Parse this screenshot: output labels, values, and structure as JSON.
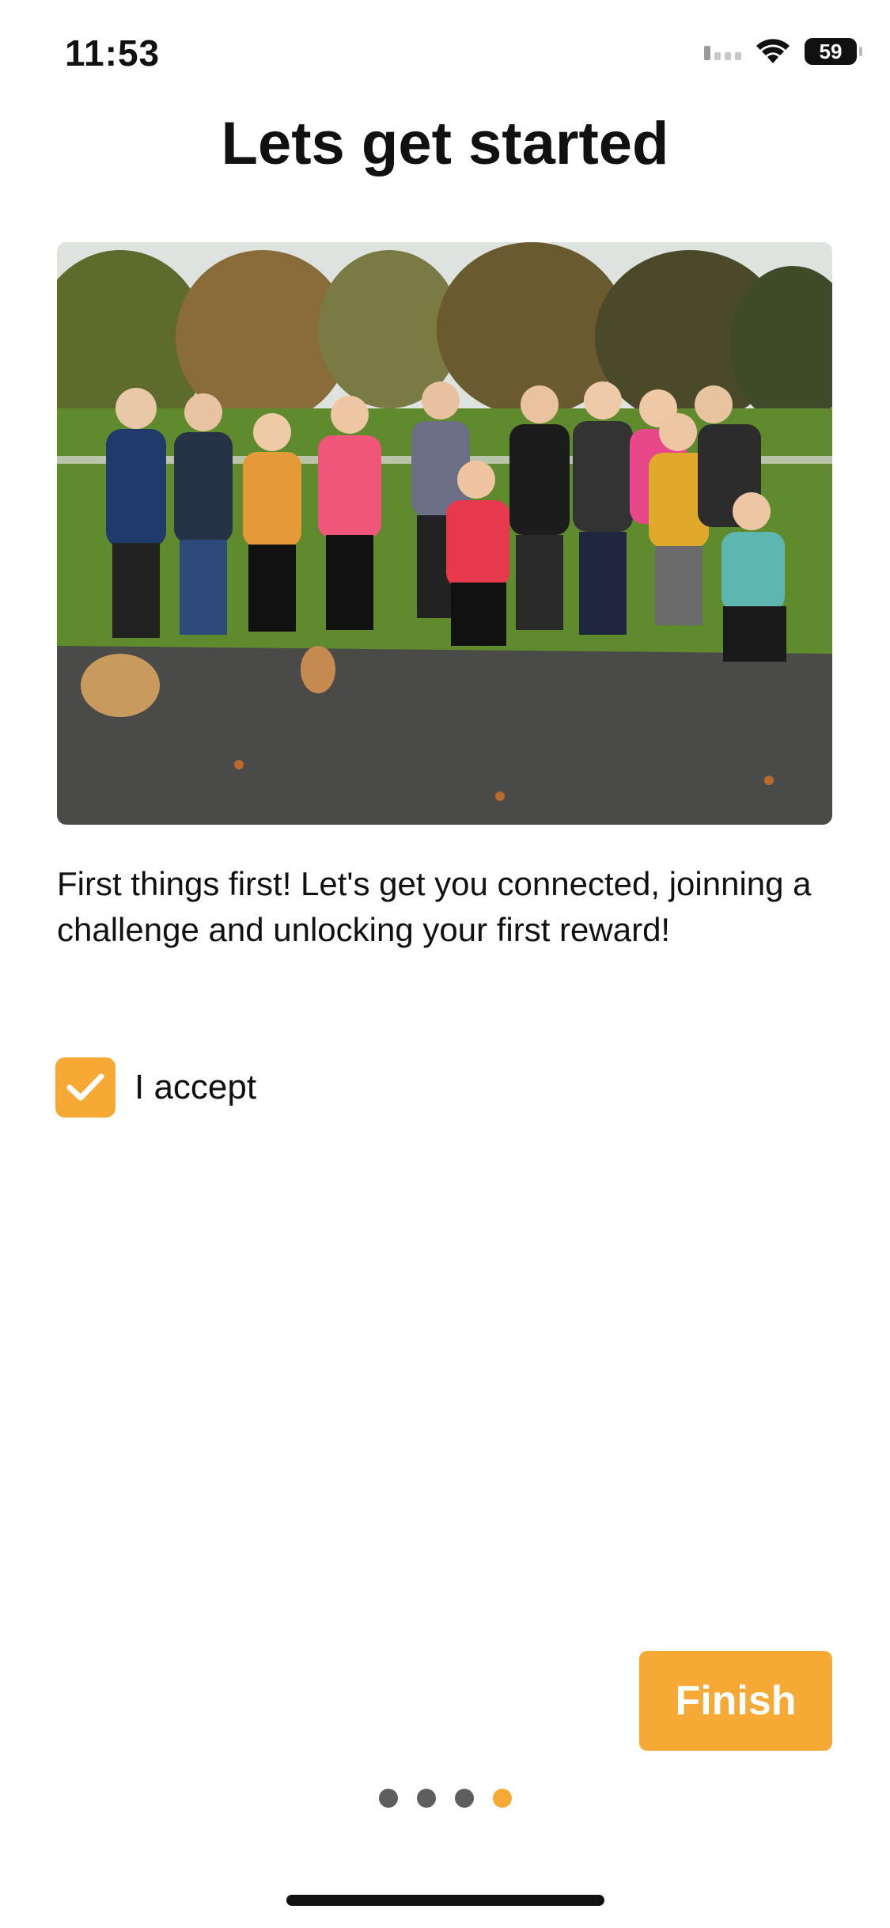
{
  "status_bar": {
    "time": "11:53",
    "battery": "59",
    "signal_icon": "cellular-signal-icon",
    "wifi_icon": "wifi-icon"
  },
  "page": {
    "title": "Lets get started"
  },
  "intro": {
    "text": "First things first! Let's get you connected, joinning a challenge and unlocking your first reward!"
  },
  "accept": {
    "label": "I accept",
    "checked": true
  },
  "actions": {
    "finish_label": "Finish"
  },
  "pager": {
    "total": 4,
    "current": 4
  },
  "colors": {
    "accent": "#f7a935",
    "dot_inactive": "#5e5e5e",
    "text": "#111111"
  }
}
